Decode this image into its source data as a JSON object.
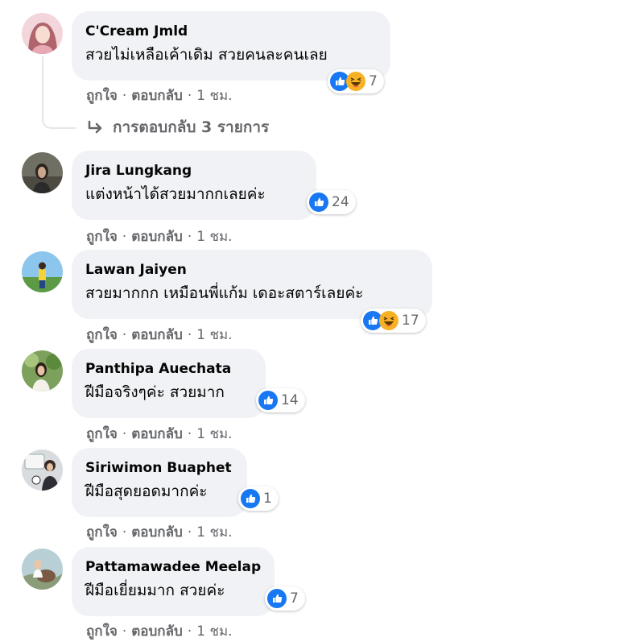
{
  "actions": {
    "like": "ถูกใจ",
    "reply": "ตอบกลับ",
    "separator": "·",
    "time": "1 ชม."
  },
  "colors": {
    "like_blue": "#1877f2",
    "haha_yellow": "#f7b125",
    "bubble_bg": "#f0f2f5",
    "meta_gray": "#65676b"
  },
  "icons": {
    "like": "like-thumbs-up-icon",
    "haha": "haha-laughing-face-icon",
    "reply_arrow": "reply-arrow-icon"
  },
  "comments": [
    {
      "author": "C'Cream Jmld",
      "text": "สวยไม่เหลือเค้าเดิม สวยคนละคนเลย",
      "reaction_count": "7",
      "reactions": [
        "like",
        "haha"
      ],
      "replies_label": "การตอบกลับ 3 รายการ"
    },
    {
      "author": "Jira Lungkang",
      "text": "แต่งหน้าได้สวยมากกเลยค่ะ",
      "reaction_count": "24",
      "reactions": [
        "like"
      ]
    },
    {
      "author": "Lawan Jaiyen",
      "text": "สวยมากกก เหมือนพี่แก้ม เดอะสตาร์เลยค่ะ",
      "reaction_count": "17",
      "reactions": [
        "like",
        "haha"
      ]
    },
    {
      "author": "Panthipa Auechata",
      "text": "ฝีมือจริงๆค่ะ สวยมาก",
      "reaction_count": "14",
      "reactions": [
        "like"
      ]
    },
    {
      "author": "Siriwimon Buaphet",
      "text": "ฝีมือสุดยอดมากค่ะ",
      "reaction_count": "1",
      "reactions": [
        "like"
      ]
    },
    {
      "author": "Pattamawadee Meelap",
      "text": "ฝีมือเยี่ยมมาก สวยค่ะ",
      "reaction_count": "7",
      "reactions": [
        "like"
      ]
    }
  ]
}
